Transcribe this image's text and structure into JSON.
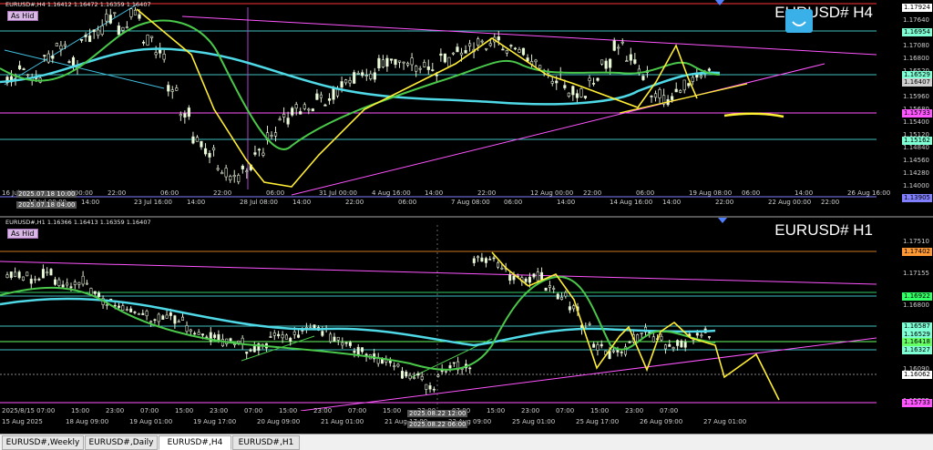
{
  "h4": {
    "header": "EURUSD#,H4  1.16412 1.16472 1.16359 1.16407",
    "ashid": "As Hid",
    "symbol": "EURUSD# H4",
    "ylim": [
      1.137,
      1.1805
    ],
    "price_labels": [
      "1.17924",
      "1.17640",
      "1.17360",
      "1.17080",
      "1.16800",
      "1.16520",
      "1.16250",
      "1.15960",
      "1.15680",
      "1.15400",
      "1.15120",
      "1.14840",
      "1.14560",
      "1.14280",
      "1.14000"
    ],
    "price_tags": [
      {
        "text": "1.17924",
        "color": "#ffffff"
      },
      {
        "text": "1.16954",
        "color": "#7fffd4"
      },
      {
        "text": "1.16529",
        "color": "#7fffd4"
      },
      {
        "text": "1.16407",
        "color": "#cfcfcf"
      },
      {
        "text": "1.15733",
        "color": "#ff55ff"
      },
      {
        "text": "1.15162",
        "color": "#7fffd4"
      },
      {
        "text": "1.13905",
        "color": "#7f7fff"
      }
    ],
    "time_labels": [
      "16 Jul 2025",
      "18 Jul 00:00",
      "21 Jul 00:00",
      "14:00",
      "22:00",
      "23 Jul 16:00",
      "06:00",
      "14:00",
      "22:00",
      "28 Jul 08:00",
      "06:00",
      "14:00",
      "31 Jul 00:00",
      "22:00",
      "4 Aug 16:00",
      "06:00",
      "14:00",
      "7 Aug 08:00",
      "22:00",
      "06:00",
      "12 Aug 00:00",
      "14:00",
      "22:00",
      "14 Aug 16:00",
      "06:00",
      "14:00",
      "19 Aug 08:00",
      "22:00",
      "06:00",
      "22 Aug 00:00",
      "14:00",
      "22:00",
      "26 Aug 16:00"
    ],
    "time_box": "2025.07.18 10:00",
    "time_box2": "2025.07.18 04:00",
    "time_box3": "1.13905"
  },
  "h1": {
    "header": "EURUSD#,H1  1.16366 1.16413 1.16359 1.16407",
    "ashid": "As Hid",
    "symbol": "EURUSD# H1",
    "ylim": [
      1.1555,
      1.177
    ],
    "price_labels": [
      "1.17510",
      "1.17155",
      "1.16800",
      "1.16445",
      "1.16090",
      "1.15735"
    ],
    "price_tags": [
      {
        "text": "1.17402",
        "color": "#ff9933"
      },
      {
        "text": "1.16922",
        "color": "#33ff66"
      },
      {
        "text": "1.16587",
        "color": "#7fffd4"
      },
      {
        "text": "1.16529",
        "color": "#7fffd4"
      },
      {
        "text": "1.16418",
        "color": "#66ff66"
      },
      {
        "text": "1.16327",
        "color": "#7fffd4"
      },
      {
        "text": "1.16062",
        "color": "#ffffff"
      },
      {
        "text": "1.15733",
        "color": "#ff55ff"
      }
    ],
    "time_labels": [
      "2025/8/15 07:00",
      "15:00",
      "23:00",
      "07:00",
      "15:00",
      "23:00",
      "07:00",
      "15:00",
      "23:00",
      "07:00",
      "15:00",
      "23:00",
      "07:00",
      "15:00",
      "23:00",
      "07:00",
      "15:00",
      "23:00",
      "07:00"
    ],
    "time_labels2": [
      "15 Aug 2025",
      "18 Aug 09:00",
      "19 Aug 01:00",
      "19 Aug 17:00",
      "20 Aug 09:00",
      "21 Aug 01:00",
      "21 Aug 17:00",
      "22 Aug 09:00",
      "25 Aug 01:00",
      "25 Aug 17:00",
      "26 Aug 09:00",
      "27 Aug 01:00"
    ],
    "time_box": "2025.08.22 12:00",
    "time_box2": "2025.08.22 06:00"
  },
  "tabs": [
    "EURUSD#,Weekly",
    "EURUSD#,Daily",
    "EURUSD#,H4",
    "EURUSD#,H1"
  ],
  "active_tab": "EURUSD#,H4"
}
